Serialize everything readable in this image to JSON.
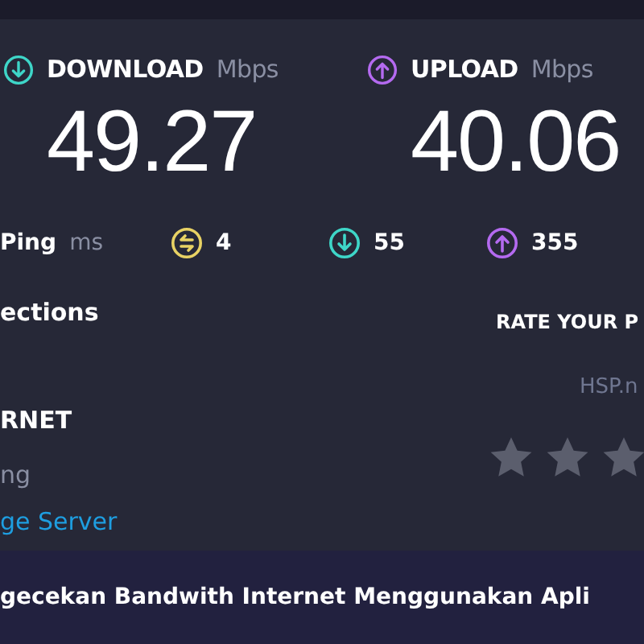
{
  "download": {
    "label": "DOWNLOAD",
    "unit": "Mbps",
    "value": "49.27"
  },
  "upload": {
    "label": "UPLOAD",
    "unit": "Mbps",
    "value": "40.06"
  },
  "ping": {
    "label": "Ping",
    "unit": "ms",
    "stats": [
      {
        "kind": "ping",
        "value": "4"
      },
      {
        "kind": "download",
        "value": "55"
      },
      {
        "kind": "upload",
        "value": "355"
      }
    ]
  },
  "connections": {
    "label": "ections"
  },
  "provider": {
    "name": "RNET",
    "detail": "ng"
  },
  "server": {
    "link": "ge Server"
  },
  "rating": {
    "title": "RATE YOUR P",
    "host": "HSP.n",
    "stars": 0
  },
  "caption": "gecekan Bandwith Internet Menggunakan Apli"
}
